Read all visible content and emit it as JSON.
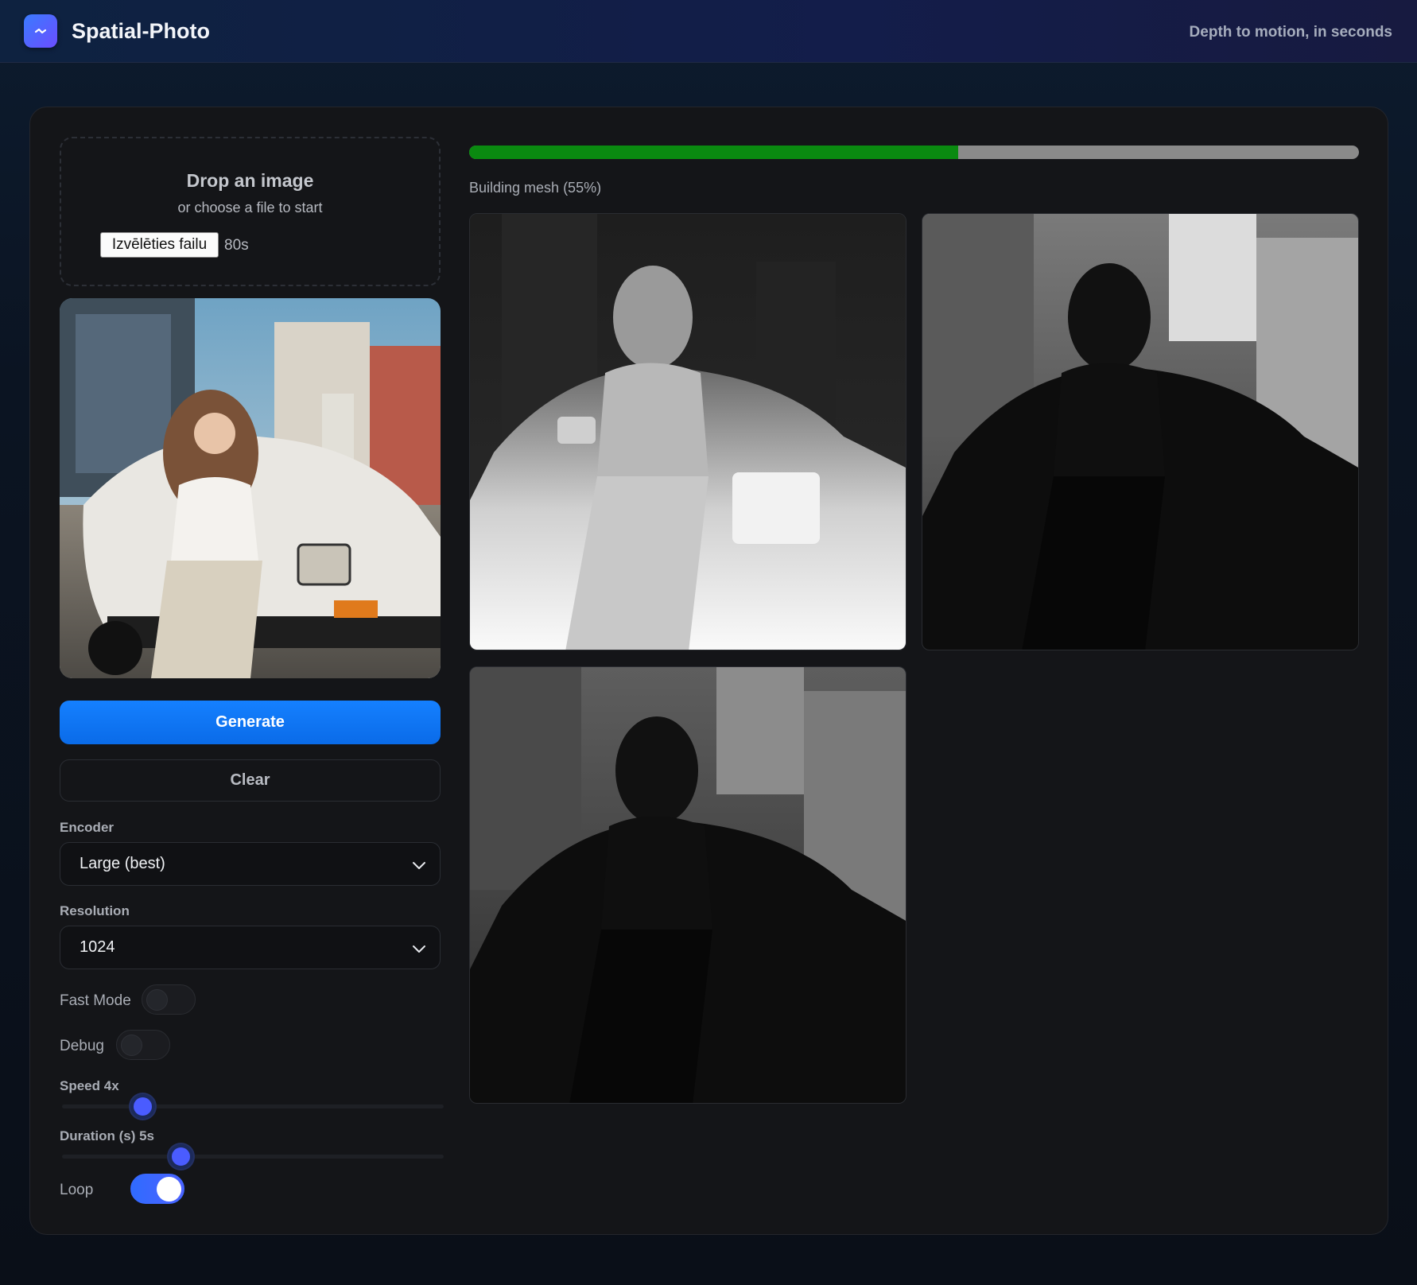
{
  "header": {
    "app_title": "Spatial-Photo",
    "tagline": "Depth to motion, in seconds",
    "logo_icon": "motion-icon"
  },
  "upload": {
    "title": "Drop an image",
    "subtitle": "or choose a file to start",
    "file_button_label": "Izvēlēties failu",
    "file_name": "80s"
  },
  "actions": {
    "generate_label": "Generate",
    "clear_label": "Clear"
  },
  "settings": {
    "encoder": {
      "label": "Encoder",
      "value": "Large (best)"
    },
    "resolution": {
      "label": "Resolution",
      "value": "1024"
    },
    "fast_mode": {
      "label": "Fast Mode",
      "on": false
    },
    "debug": {
      "label": "Debug",
      "on": false
    },
    "speed": {
      "label": "Speed 4x",
      "fraction": 0.21
    },
    "duration": {
      "label": "Duration (s) 5s",
      "fraction": 0.31
    },
    "loop": {
      "label": "Loop",
      "on": true
    }
  },
  "progress": {
    "text": "Building mesh (55%)",
    "fraction": 0.55
  },
  "colors": {
    "accent": "#0a6be8",
    "progress_fill": "#0a8a10",
    "toggle_on": "#3a67ff"
  }
}
